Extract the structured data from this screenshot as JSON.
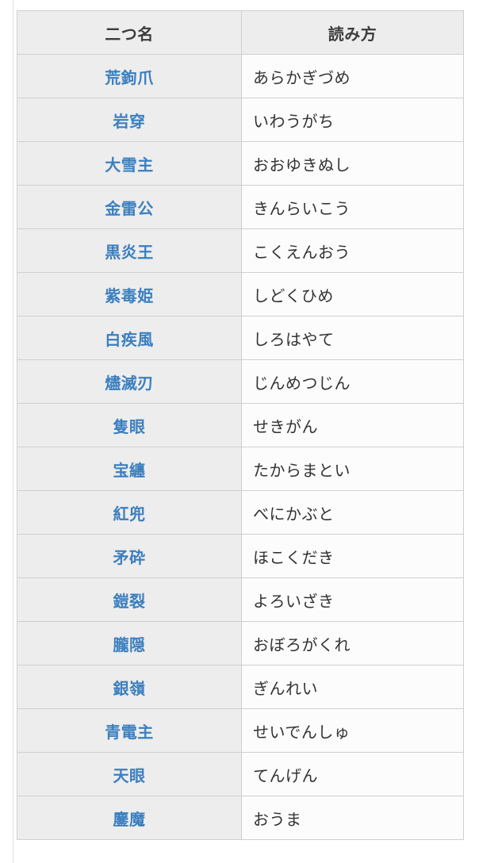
{
  "page": {
    "background_color": "#ffffff",
    "gutter_line_color": "#e6e6ea"
  },
  "table": {
    "name": "deviant-monster-names-table",
    "border_color": "#cfcfcf",
    "header_background": "#ededed",
    "name_cell_background": "#ededed",
    "reading_cell_background": "#fcfcfc",
    "link_color": "#3b7fc0",
    "header_text_color": "#3c3c3c",
    "body_text_color": "#333333",
    "columns": [
      {
        "key": "name",
        "label": "二つ名"
      },
      {
        "key": "reading",
        "label": "読み方"
      }
    ],
    "rows": [
      {
        "name": "荒鉤爪",
        "reading": "あらかぎづめ"
      },
      {
        "name": "岩穿",
        "reading": "いわうがち"
      },
      {
        "name": "大雪主",
        "reading": "おおゆきぬし"
      },
      {
        "name": "金雷公",
        "reading": "きんらいこう"
      },
      {
        "name": "黒炎王",
        "reading": "こくえんおう"
      },
      {
        "name": "紫毒姫",
        "reading": "しどくひめ"
      },
      {
        "name": "白疾風",
        "reading": "しろはやて"
      },
      {
        "name": "燼滅刃",
        "reading": "じんめつじん"
      },
      {
        "name": "隻眼",
        "reading": "せきがん"
      },
      {
        "name": "宝纏",
        "reading": "たからまとい"
      },
      {
        "name": "紅兜",
        "reading": "べにかぶと"
      },
      {
        "name": "矛砕",
        "reading": "ほこくだき"
      },
      {
        "name": "鎧裂",
        "reading": "よろいざき"
      },
      {
        "name": "朧隠",
        "reading": "おぼろがくれ"
      },
      {
        "name": "銀嶺",
        "reading": "ぎんれい"
      },
      {
        "name": "青電主",
        "reading": "せいでんしゅ"
      },
      {
        "name": "天眼",
        "reading": "てんげん"
      },
      {
        "name": "鏖魔",
        "reading": "おうま"
      }
    ]
  }
}
